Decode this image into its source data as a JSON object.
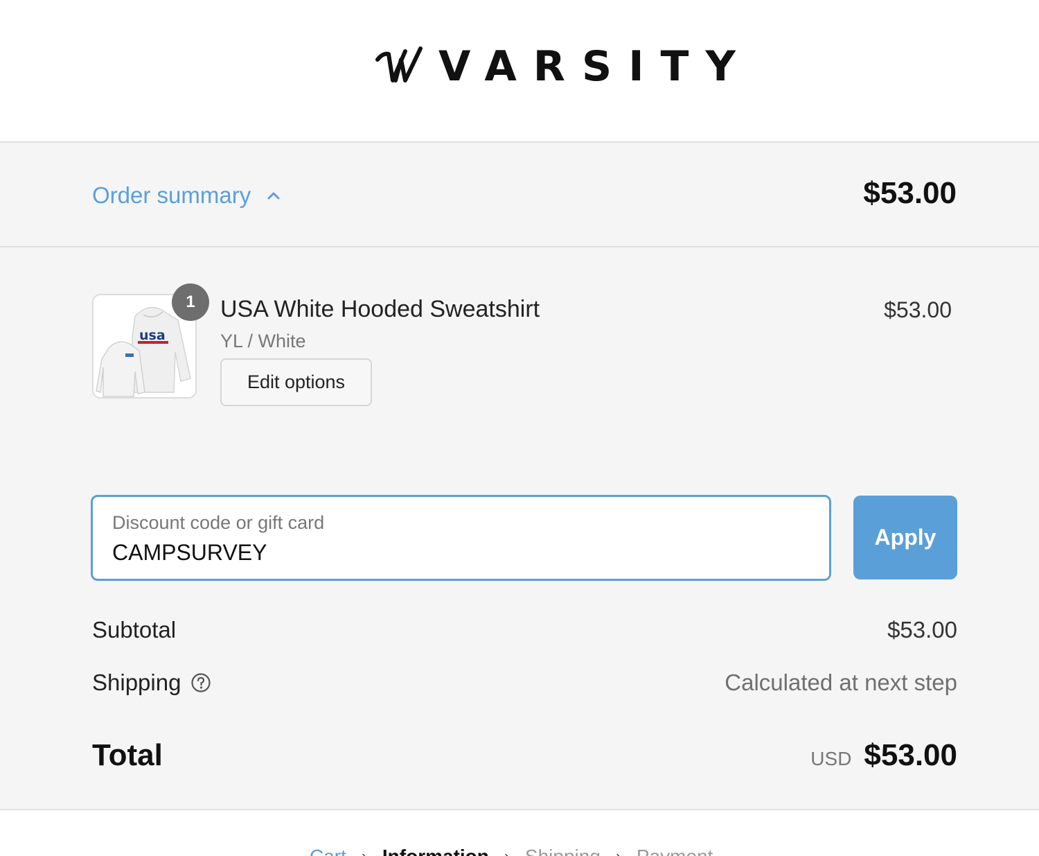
{
  "brand": {
    "name": "VARSITY",
    "accent_color": "#5b9fd8"
  },
  "order_summary": {
    "toggle_label": "Order summary",
    "toggle_icon": "chevron-up-icon",
    "total": "$53.00"
  },
  "line_item": {
    "quantity": "1",
    "name": "USA White Hooded Sweatshirt",
    "variant": "YL / White",
    "edit_label": "Edit options",
    "price": "$53.00",
    "image_text": "usa"
  },
  "discount": {
    "label": "Discount code or gift card",
    "value": "CAMPSURVEY",
    "apply_label": "Apply"
  },
  "totals": {
    "subtotal_label": "Subtotal",
    "subtotal_value": "$53.00",
    "shipping_label": "Shipping",
    "shipping_value": "Calculated at next step",
    "total_label": "Total",
    "currency": "USD",
    "total_value": "$53.00"
  },
  "breadcrumb": {
    "items": [
      "Cart",
      "Information",
      "Shipping",
      "Payment"
    ],
    "separator": "›"
  }
}
